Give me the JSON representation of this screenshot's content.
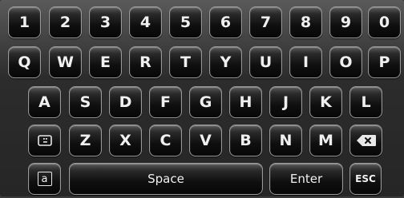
{
  "keyboard": {
    "row1": [
      "1",
      "2",
      "3",
      "4",
      "5",
      "6",
      "7",
      "8",
      "9",
      "0"
    ],
    "row2": [
      "Q",
      "W",
      "E",
      "R",
      "T",
      "Y",
      "U",
      "I",
      "O",
      "P"
    ],
    "row3": [
      "A",
      "S",
      "D",
      "F",
      "G",
      "H",
      "J",
      "K",
      "L"
    ],
    "row4": [
      "Z",
      "X",
      "C",
      "V",
      "B",
      "N",
      "M"
    ],
    "space_label": "Space",
    "enter_label": "Enter",
    "esc_label": "ESC",
    "case_toggle_label": "a",
    "icons": {
      "symbol_toggle": "symbols-icon",
      "backspace": "backspace-icon"
    }
  }
}
